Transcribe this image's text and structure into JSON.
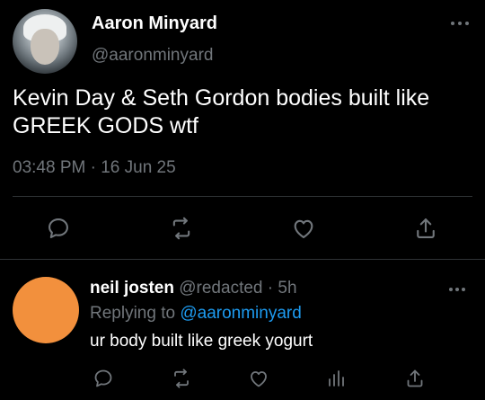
{
  "tweet": {
    "author_name": "Aaron Minyard",
    "author_handle": "@aaronminyard",
    "text": "Kevin Day & Seth Gordon bodies built like GREEK GODS wtf",
    "time": "03:48 PM",
    "separator": " · ",
    "date": "16 Jun 25"
  },
  "reply": {
    "author_name": "neil josten",
    "author_handle": "@redacted",
    "separator": " · ",
    "age": "5h",
    "replying_prefix": "Replying to ",
    "replying_to": "@aaronminyard",
    "text": "ur body built like greek yogurt",
    "avatar_color": "#f2903d"
  },
  "icons": {
    "more": "more-dots-icon",
    "reply": "reply-bubble-icon",
    "retweet": "retweet-icon",
    "like": "heart-icon",
    "views": "analytics-bars-icon",
    "share": "share-upload-icon"
  },
  "colors": {
    "background": "#000000",
    "text": "#ffffff",
    "muted": "#71767b",
    "link": "#1d9bf0",
    "divider": "#2f3336"
  }
}
